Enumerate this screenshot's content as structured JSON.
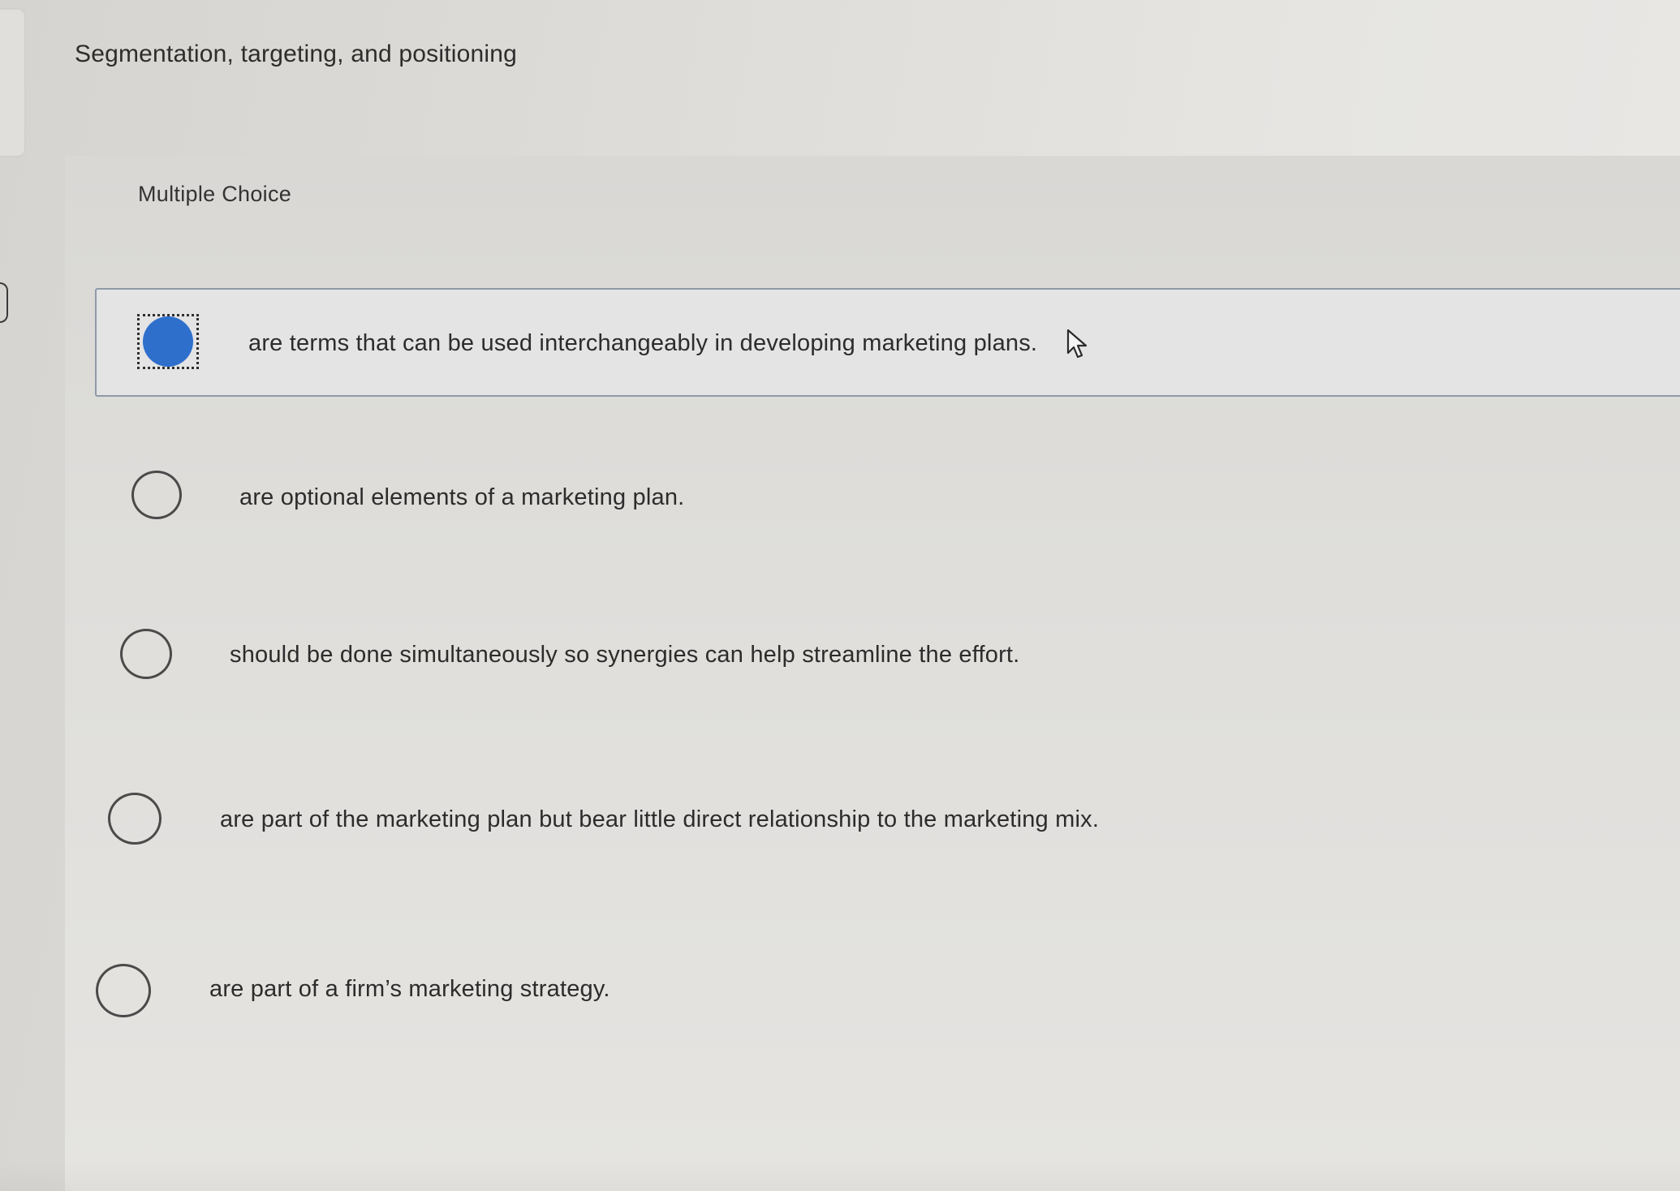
{
  "question": {
    "title": "Segmentation, targeting, and positioning"
  },
  "card": {
    "type_label": "Multiple Choice"
  },
  "options": [
    {
      "text": "are terms that can be used interchangeably in developing marketing plans.",
      "selected": true
    },
    {
      "text": "are optional elements of a marketing plan.",
      "selected": false
    },
    {
      "text": "should be done simultaneously so synergies can help streamline the effort.",
      "selected": false
    },
    {
      "text": "are part of the marketing plan but bear little direct relationship to the marketing mix.",
      "selected": false
    },
    {
      "text": "are part of a firm’s marketing strategy.",
      "selected": false
    }
  ],
  "colors": {
    "selected_radio": "#2f6fcc",
    "selected_border": "#8f9aa8"
  },
  "icons": {
    "cursor": "mouse-pointer-icon"
  }
}
